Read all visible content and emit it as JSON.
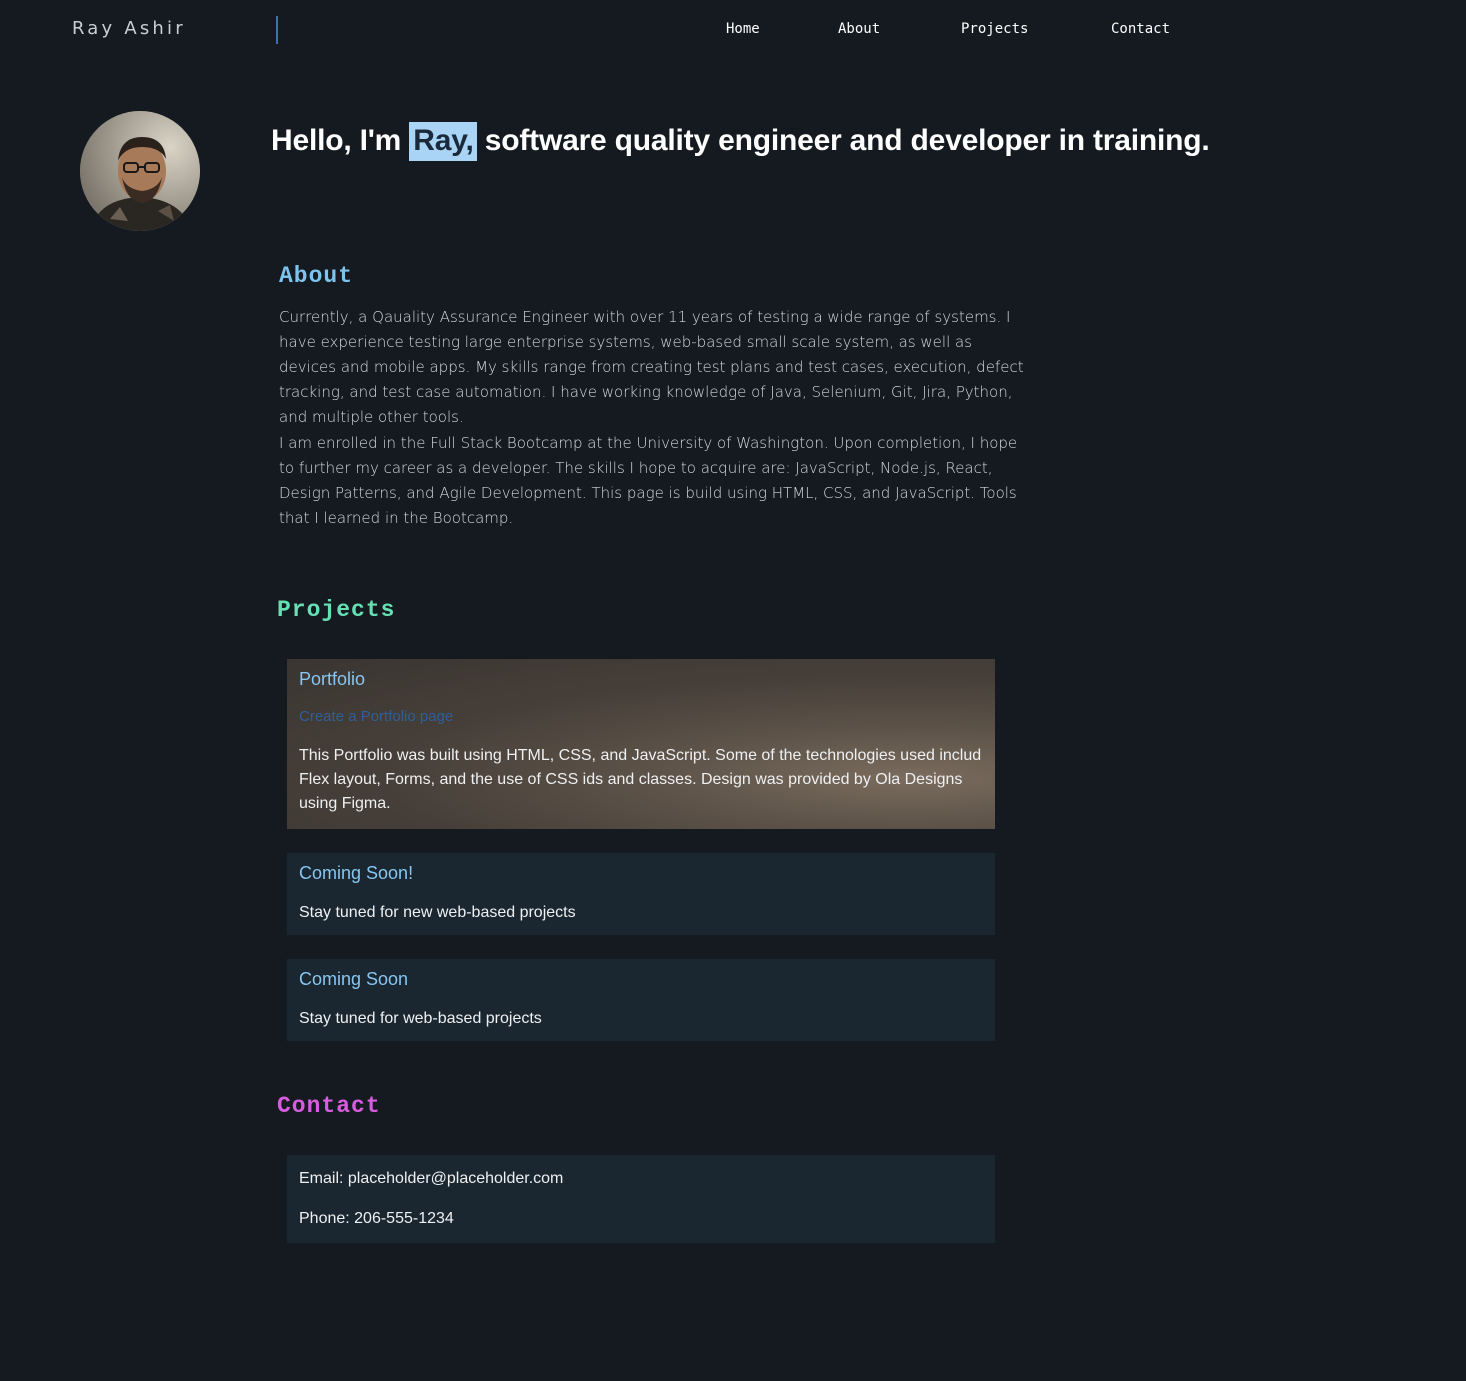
{
  "header": {
    "brand": "Ray Ashir",
    "nav": [
      "Home",
      "About",
      "Projects",
      "Contact"
    ]
  },
  "hero": {
    "before": "Hello, I'm ",
    "highlight": "Ray,",
    "after": " software quality engineer and developer in training."
  },
  "about": {
    "title": "About",
    "paragraphs": [
      "Currently, a Qauality Assurance Engineer with over 11 years of testing a wide range of systems. I have experience testing large enterprise systems, web-based small scale system, as well as devices and mobile apps. My skills range from creating test plans and test cases, execution, defect tracking, and test case automation. I have working knowledge of Java, Selenium, Git, Jira, Python, and multiple other tools.",
      "I am enrolled in the Full Stack Bootcamp at the University of Washington. Upon completion, I hope to further my career as a developer. The skills I hope to acquire are: JavaScript, Node.js, React, Design Patterns, and Agile Development. This page is build using HTML, CSS, and JavaScript. Tools that I learned in the Bootcamp."
    ]
  },
  "projects": {
    "title": "Projects",
    "items": [
      {
        "title": "Portfolio",
        "link": "Create a Portfolio page",
        "description": "This Portfolio was built using HTML, CSS, and JavaScript. Some of the technologies used includ Flex layout, Forms, and the use of CSS ids and classes. Design was provided by Ola Designs using Figma."
      },
      {
        "title": "Coming Soon!",
        "description": "Stay tuned for new web-based projects"
      },
      {
        "title": "Coming Soon",
        "description": "Stay tuned for web-based projects"
      }
    ]
  },
  "contact": {
    "title": "Contact",
    "email": "Email: placeholder@placeholder.com",
    "phone": "Phone: 206-555-1234"
  },
  "colors": {
    "background": "#141a1f",
    "about_heading": "#7cc4ee",
    "projects_heading": "#66e0b3",
    "contact_heading": "#d85ce0",
    "highlight": "#a9d4f5"
  }
}
